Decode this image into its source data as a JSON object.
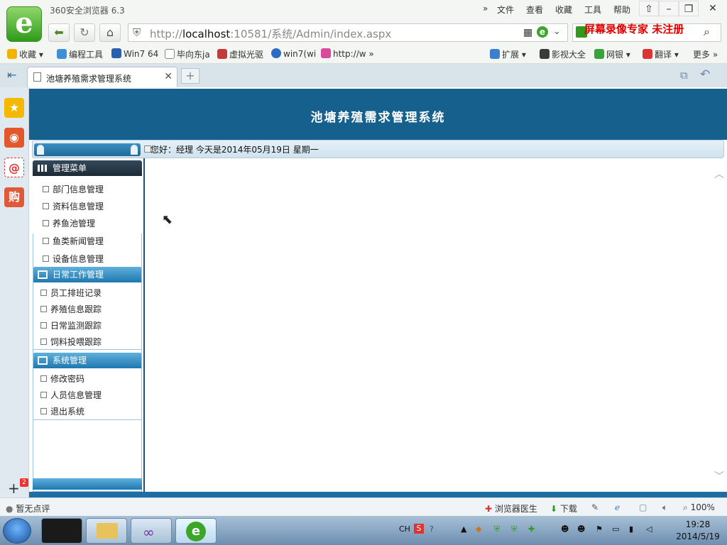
{
  "browser": {
    "app_title": "360安全浏览器 6.3",
    "menu": [
      "文件",
      "查看",
      "收藏",
      "工具",
      "帮助"
    ],
    "url_prefix": "http://",
    "url_host": "localhost",
    "url_rest": ":10581/系统/Admin/index.aspx",
    "watermark": "屏幕录像专家  未注册",
    "bookmarks": [
      "收藏",
      "编程工具",
      "Win7 64",
      "毕向东ja",
      "虚拟光驱",
      "win7(wi",
      "http://w"
    ],
    "bookmarks_right": [
      "扩展",
      "影视大全",
      "网银",
      "翻译",
      "更多"
    ],
    "tab_title": "池塘养殖需求管理系统",
    "dock_badge": "2"
  },
  "page": {
    "system_title": "池塘养殖需求管理系统",
    "greeting": "您好：经理    今天是2014年05月19日    星期一",
    "menu_groups": [
      {
        "title": "管理菜单",
        "items": [
          "部门信息管理",
          "资料信息管理",
          "养鱼池管理",
          "鱼类新闻管理",
          "设备信息管理"
        ]
      },
      {
        "title": "日常工作管理",
        "items": [
          "员工排班记录",
          "养殖信息跟踪",
          "日常监测跟踪",
          "饲料投喂跟踪"
        ]
      },
      {
        "title": "系统管理",
        "items": [
          "修改密码",
          "人员信息管理",
          "退出系统"
        ]
      }
    ]
  },
  "statusbar": {
    "left": "暂无点评",
    "doctor": "浏览器医生",
    "download": "下载",
    "zoom": "100%"
  },
  "taskbar": {
    "lang": "CH",
    "time": "19:28",
    "date": "2014/5/19"
  },
  "colors": {
    "banner": "#16608e",
    "accent_green": "#2f9a1c",
    "watermark_red": "#e00000"
  }
}
